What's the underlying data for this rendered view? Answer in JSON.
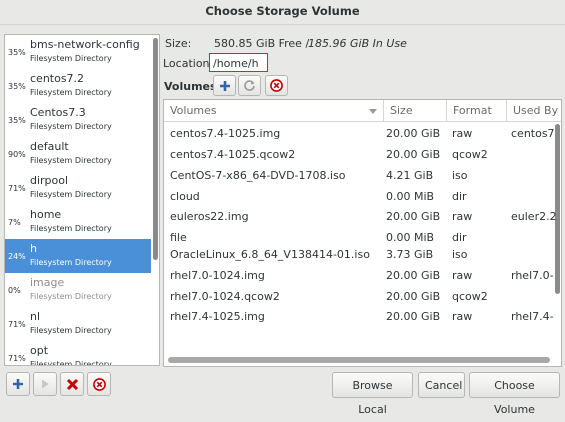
{
  "window": {
    "title": "Choose Storage Volume"
  },
  "pools": [
    {
      "pct": "35%",
      "name": "bms-network-config",
      "type": "Filesystem Directory",
      "selected": false,
      "inactive": false
    },
    {
      "pct": "35%",
      "name": "centos7.2",
      "type": "Filesystem Directory",
      "selected": false,
      "inactive": false
    },
    {
      "pct": "35%",
      "name": "Centos7.3",
      "type": "Filesystem Directory",
      "selected": false,
      "inactive": false
    },
    {
      "pct": "90%",
      "name": "default",
      "type": "Filesystem Directory",
      "selected": false,
      "inactive": false
    },
    {
      "pct": "71%",
      "name": "dirpool",
      "type": "Filesystem Directory",
      "selected": false,
      "inactive": false
    },
    {
      "pct": "7%",
      "name": "home",
      "type": "Filesystem Directory",
      "selected": false,
      "inactive": false
    },
    {
      "pct": "24%",
      "name": "h",
      "type": "Filesystem Directory",
      "selected": true,
      "inactive": false
    },
    {
      "pct": "0%",
      "name": "image",
      "type": "Filesystem Directory",
      "selected": false,
      "inactive": true
    },
    {
      "pct": "71%",
      "name": "nl",
      "type": "Filesystem Directory",
      "selected": false,
      "inactive": false
    },
    {
      "pct": "71%",
      "name": "opt",
      "type": "Filesystem Directory",
      "selected": false,
      "inactive": false
    }
  ],
  "details": {
    "size_label": "Size:",
    "size_free": "580.85 GiB Free /",
    "size_used": "185.96 GiB In Use",
    "location_label": "Location:",
    "location_value": "/home/h",
    "volumes_label": "Volumes"
  },
  "table": {
    "columns": [
      "Volumes",
      "Size",
      "Format",
      "Used By"
    ],
    "rows": [
      {
        "name": "centos7.4-1025.img",
        "size": "20.00 GiB",
        "format": "raw",
        "used_by": "centos7"
      },
      {
        "name": "centos7.4-1025.qcow2",
        "size": "20.00 GiB",
        "format": "qcow2",
        "used_by": ""
      },
      {
        "name": "CentOS-7-x86_64-DVD-1708.iso",
        "size": "4.21 GiB",
        "format": "iso",
        "used_by": ""
      },
      {
        "name": "cloud",
        "size": "0.00 MiB",
        "format": "dir",
        "used_by": ""
      },
      {
        "name": "euleros22.img",
        "size": "20.00 GiB",
        "format": "raw",
        "used_by": "euler2.2"
      },
      {
        "name": "file",
        "size": "0.00 MiB",
        "format": "dir",
        "used_by": ""
      },
      {
        "name": "OracleLinux_6.8_64_V138414-01.iso",
        "size": "3.73 GiB",
        "format": "iso",
        "used_by": ""
      },
      {
        "name": "rhel7.0-1024.img",
        "size": "20.00 GiB",
        "format": "raw",
        "used_by": "rhel7.0-"
      },
      {
        "name": "rhel7.0-1024.qcow2",
        "size": "20.00 GiB",
        "format": "qcow2",
        "used_by": ""
      },
      {
        "name": "rhel7.4-1025.img",
        "size": "20.00 GiB",
        "format": "raw",
        "used_by": "rhel7.4-"
      }
    ]
  },
  "buttons": {
    "browse_local": "Browse Local",
    "cancel": "Cancel",
    "choose_volume": "Choose Volume"
  },
  "colors": {
    "selection": "#4a90d9",
    "delete": "#cc0000",
    "add": "#3465a4",
    "location_border": "#dd2222"
  }
}
